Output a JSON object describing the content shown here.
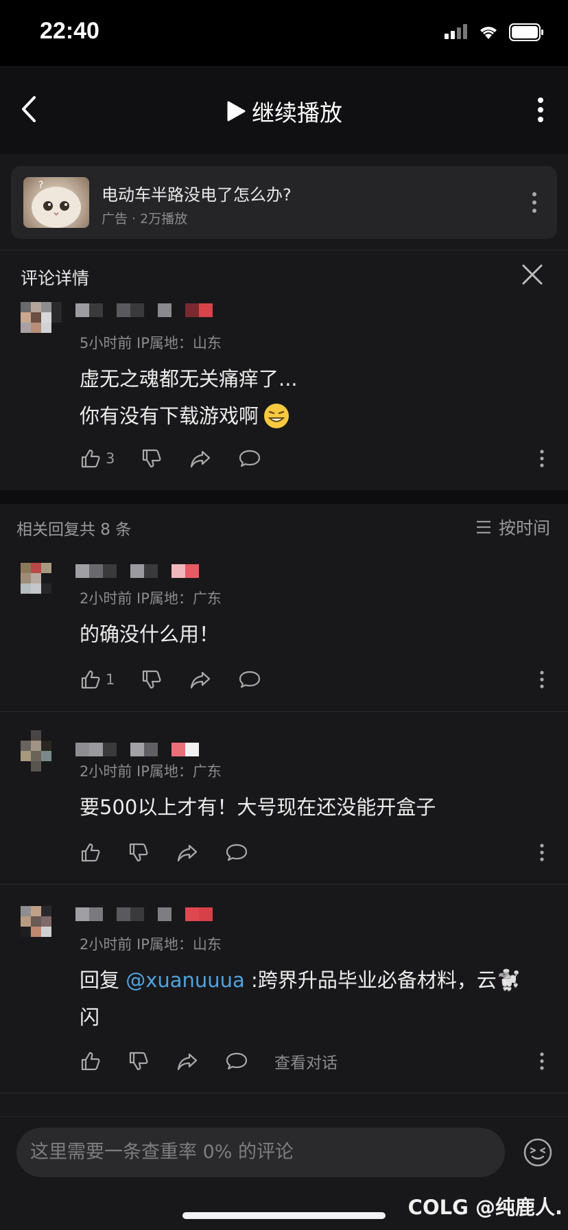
{
  "status": {
    "time": "22:40"
  },
  "nav": {
    "title": "继续播放"
  },
  "ad": {
    "title": "电动车半路没电了怎么办?",
    "subtitle": "广告 · 2万播放"
  },
  "detail": {
    "title": "评论详情"
  },
  "main_comment": {
    "meta": "5小时前  IP属地：山东",
    "line1": "虚无之魂都无关痛痒了...",
    "line2": "你有没有下载游戏啊",
    "like_count": "3"
  },
  "replies_header": {
    "count_label": "相关回复共 8 条",
    "sort_label": "按时间"
  },
  "replies": [
    {
      "meta": "2小时前  IP属地：广东",
      "text": "的确没什么用！",
      "like_count": "1"
    },
    {
      "meta": "2小时前  IP属地：广东",
      "text": "要500以上才有！大号现在还没能开盒子",
      "like_count": ""
    },
    {
      "meta": "2小时前  IP属地：山东",
      "prefix": "回复 ",
      "mention": "@xuanuuua",
      "text": " :跨界升品毕业必备材料，云🐩",
      "text2": "闪",
      "like_count": "",
      "view_conversation": "查看对话"
    }
  ],
  "input": {
    "placeholder": "这里需要一条查重率 0% 的评论"
  },
  "watermark": "COLG @纯鹿人."
}
